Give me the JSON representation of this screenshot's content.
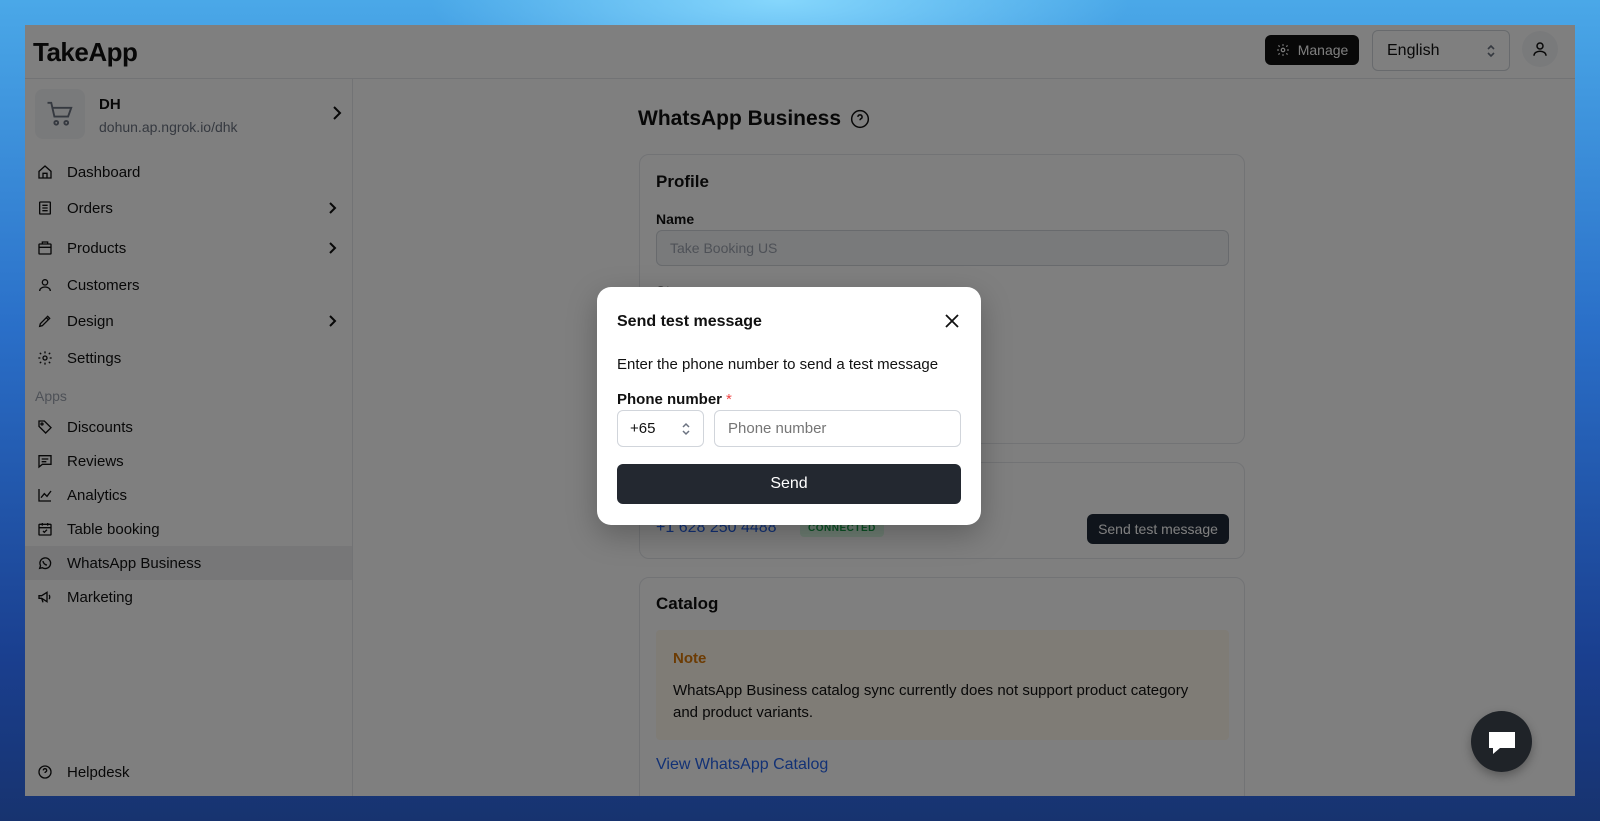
{
  "app": {
    "logo": "TakeApp",
    "manage_label": "Manage",
    "language": "English"
  },
  "store": {
    "name": "DH",
    "url": "dohun.ap.ngrok.io/dhk"
  },
  "sidebar": {
    "items": [
      {
        "label": "Dashboard",
        "icon": "home-icon"
      },
      {
        "label": "Orders",
        "icon": "orders-icon",
        "has_children": true
      },
      {
        "label": "Products",
        "icon": "products-icon",
        "has_children": true
      },
      {
        "label": "Customers",
        "icon": "user-icon"
      },
      {
        "label": "Design",
        "icon": "pen-icon",
        "has_children": true
      },
      {
        "label": "Settings",
        "icon": "gear-icon"
      }
    ],
    "apps_section": "Apps",
    "apps": [
      {
        "label": "Discounts",
        "icon": "tag-icon"
      },
      {
        "label": "Reviews",
        "icon": "message-icon"
      },
      {
        "label": "Analytics",
        "icon": "chart-icon"
      },
      {
        "label": "Table booking",
        "icon": "calendar-icon"
      },
      {
        "label": "WhatsApp Business",
        "icon": "whatsapp-icon",
        "active": true
      },
      {
        "label": "Marketing",
        "icon": "megaphone-icon"
      }
    ],
    "helpdesk": "Helpdesk"
  },
  "main": {
    "title": "WhatsApp Business",
    "profile": {
      "title": "Profile",
      "name_label": "Name",
      "name_value": "Take Booking US",
      "status_label_partial": "St..."
    },
    "phone": {
      "number": "+1 628 250 4488",
      "status": "CONNECTED",
      "send_test_label": "Send test message"
    },
    "catalog": {
      "title": "Catalog",
      "note_title": "Note",
      "note_text": "WhatsApp Business catalog sync currently does not support product category and product variants.",
      "link": "View WhatsApp Catalog"
    }
  },
  "modal": {
    "title": "Send test message",
    "description": "Enter the phone number to send a test message",
    "phone_label": "Phone number",
    "required_mark": "*",
    "country_code": "+65",
    "phone_placeholder": "Phone number",
    "send_label": "Send"
  },
  "colors": {
    "accent_dark": "#232830",
    "link": "#2563eb",
    "connected": "#16a34a",
    "note": "#d97706"
  }
}
